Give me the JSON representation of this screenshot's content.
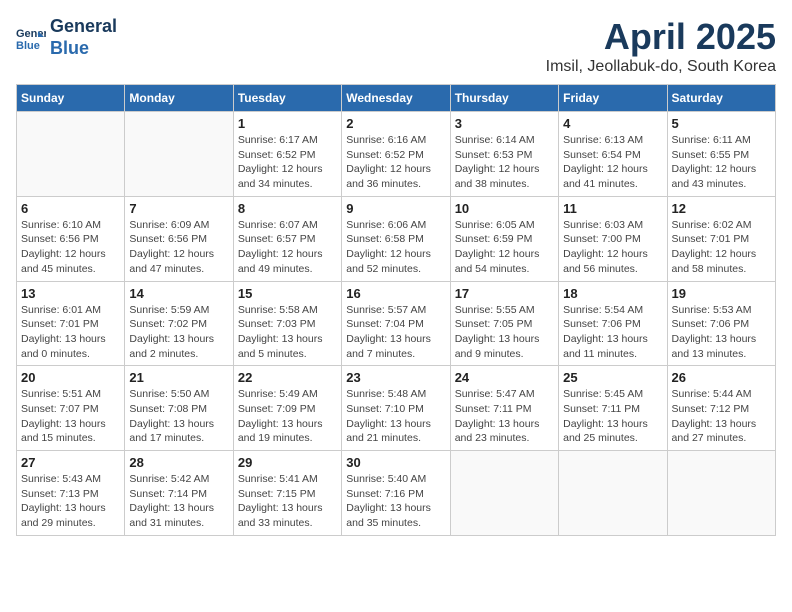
{
  "header": {
    "logo_line1": "General",
    "logo_line2": "Blue",
    "title": "April 2025",
    "subtitle": "Imsil, Jeollabuk-do, South Korea"
  },
  "weekdays": [
    "Sunday",
    "Monday",
    "Tuesday",
    "Wednesday",
    "Thursday",
    "Friday",
    "Saturday"
  ],
  "weeks": [
    [
      {
        "day": "",
        "info": ""
      },
      {
        "day": "",
        "info": ""
      },
      {
        "day": "1",
        "info": "Sunrise: 6:17 AM\nSunset: 6:52 PM\nDaylight: 12 hours\nand 34 minutes."
      },
      {
        "day": "2",
        "info": "Sunrise: 6:16 AM\nSunset: 6:52 PM\nDaylight: 12 hours\nand 36 minutes."
      },
      {
        "day": "3",
        "info": "Sunrise: 6:14 AM\nSunset: 6:53 PM\nDaylight: 12 hours\nand 38 minutes."
      },
      {
        "day": "4",
        "info": "Sunrise: 6:13 AM\nSunset: 6:54 PM\nDaylight: 12 hours\nand 41 minutes."
      },
      {
        "day": "5",
        "info": "Sunrise: 6:11 AM\nSunset: 6:55 PM\nDaylight: 12 hours\nand 43 minutes."
      }
    ],
    [
      {
        "day": "6",
        "info": "Sunrise: 6:10 AM\nSunset: 6:56 PM\nDaylight: 12 hours\nand 45 minutes."
      },
      {
        "day": "7",
        "info": "Sunrise: 6:09 AM\nSunset: 6:56 PM\nDaylight: 12 hours\nand 47 minutes."
      },
      {
        "day": "8",
        "info": "Sunrise: 6:07 AM\nSunset: 6:57 PM\nDaylight: 12 hours\nand 49 minutes."
      },
      {
        "day": "9",
        "info": "Sunrise: 6:06 AM\nSunset: 6:58 PM\nDaylight: 12 hours\nand 52 minutes."
      },
      {
        "day": "10",
        "info": "Sunrise: 6:05 AM\nSunset: 6:59 PM\nDaylight: 12 hours\nand 54 minutes."
      },
      {
        "day": "11",
        "info": "Sunrise: 6:03 AM\nSunset: 7:00 PM\nDaylight: 12 hours\nand 56 minutes."
      },
      {
        "day": "12",
        "info": "Sunrise: 6:02 AM\nSunset: 7:01 PM\nDaylight: 12 hours\nand 58 minutes."
      }
    ],
    [
      {
        "day": "13",
        "info": "Sunrise: 6:01 AM\nSunset: 7:01 PM\nDaylight: 13 hours\nand 0 minutes."
      },
      {
        "day": "14",
        "info": "Sunrise: 5:59 AM\nSunset: 7:02 PM\nDaylight: 13 hours\nand 2 minutes."
      },
      {
        "day": "15",
        "info": "Sunrise: 5:58 AM\nSunset: 7:03 PM\nDaylight: 13 hours\nand 5 minutes."
      },
      {
        "day": "16",
        "info": "Sunrise: 5:57 AM\nSunset: 7:04 PM\nDaylight: 13 hours\nand 7 minutes."
      },
      {
        "day": "17",
        "info": "Sunrise: 5:55 AM\nSunset: 7:05 PM\nDaylight: 13 hours\nand 9 minutes."
      },
      {
        "day": "18",
        "info": "Sunrise: 5:54 AM\nSunset: 7:06 PM\nDaylight: 13 hours\nand 11 minutes."
      },
      {
        "day": "19",
        "info": "Sunrise: 5:53 AM\nSunset: 7:06 PM\nDaylight: 13 hours\nand 13 minutes."
      }
    ],
    [
      {
        "day": "20",
        "info": "Sunrise: 5:51 AM\nSunset: 7:07 PM\nDaylight: 13 hours\nand 15 minutes."
      },
      {
        "day": "21",
        "info": "Sunrise: 5:50 AM\nSunset: 7:08 PM\nDaylight: 13 hours\nand 17 minutes."
      },
      {
        "day": "22",
        "info": "Sunrise: 5:49 AM\nSunset: 7:09 PM\nDaylight: 13 hours\nand 19 minutes."
      },
      {
        "day": "23",
        "info": "Sunrise: 5:48 AM\nSunset: 7:10 PM\nDaylight: 13 hours\nand 21 minutes."
      },
      {
        "day": "24",
        "info": "Sunrise: 5:47 AM\nSunset: 7:11 PM\nDaylight: 13 hours\nand 23 minutes."
      },
      {
        "day": "25",
        "info": "Sunrise: 5:45 AM\nSunset: 7:11 PM\nDaylight: 13 hours\nand 25 minutes."
      },
      {
        "day": "26",
        "info": "Sunrise: 5:44 AM\nSunset: 7:12 PM\nDaylight: 13 hours\nand 27 minutes."
      }
    ],
    [
      {
        "day": "27",
        "info": "Sunrise: 5:43 AM\nSunset: 7:13 PM\nDaylight: 13 hours\nand 29 minutes."
      },
      {
        "day": "28",
        "info": "Sunrise: 5:42 AM\nSunset: 7:14 PM\nDaylight: 13 hours\nand 31 minutes."
      },
      {
        "day": "29",
        "info": "Sunrise: 5:41 AM\nSunset: 7:15 PM\nDaylight: 13 hours\nand 33 minutes."
      },
      {
        "day": "30",
        "info": "Sunrise: 5:40 AM\nSunset: 7:16 PM\nDaylight: 13 hours\nand 35 minutes."
      },
      {
        "day": "",
        "info": ""
      },
      {
        "day": "",
        "info": ""
      },
      {
        "day": "",
        "info": ""
      }
    ]
  ]
}
